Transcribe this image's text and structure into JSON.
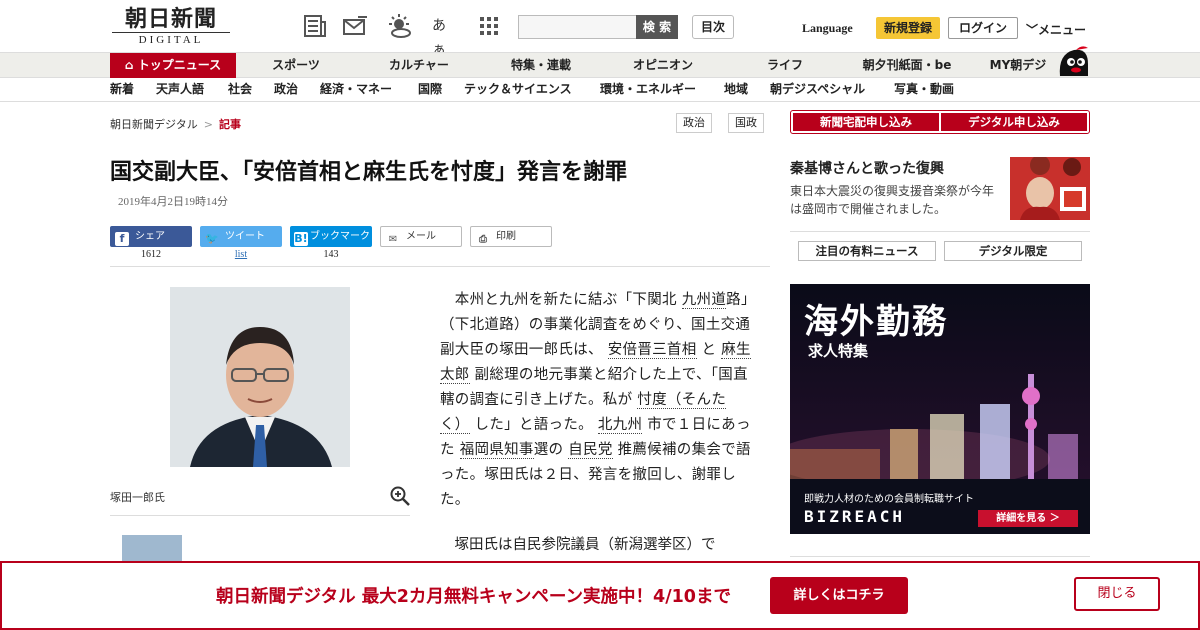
{
  "header": {
    "logo_main": "朝日新聞",
    "logo_sub": "DIGITAL",
    "icons": [
      "newspaper-icon",
      "mail-icon",
      "weather-icon",
      "font-size-icon",
      "grid-menu-icon"
    ],
    "font_icon_text": "あぁ",
    "search_placeholder": "",
    "search_button": "検 索",
    "contents_button": "目次",
    "language": "Language",
    "register": "新規登録",
    "login": "ログイン",
    "menu": "メニュー"
  },
  "main_nav": [
    {
      "label": "トップニュース",
      "active": true
    },
    {
      "label": "スポーツ"
    },
    {
      "label": "カルチャー"
    },
    {
      "label": "特集・連載"
    },
    {
      "label": "オピニオン"
    },
    {
      "label": "ライフ"
    },
    {
      "label": "朝夕刊紙面・be"
    },
    {
      "label": "MY朝デジ"
    }
  ],
  "sub_nav": [
    "新着",
    "天声人語",
    "社会",
    "政治",
    "経済・マネー",
    "国際",
    "テック＆サイエンス",
    "環境・エネルギー",
    "地域",
    "朝デジスペシャル",
    "写真・動画"
  ],
  "breadcrumb": {
    "home": "朝日新聞デジタル",
    "sep": ">",
    "current": "記事"
  },
  "tags": [
    "政治",
    "国政"
  ],
  "article": {
    "headline": "国交副大臣、「安倍首相と麻生氏を忖度」発言を謝罪",
    "date": "2019年4月2日19時14分",
    "photo_caption": "塚田一郎氏",
    "para2": "　塚田氏は自民参院議員（新潟選挙区）で"
  },
  "share": {
    "facebook": {
      "label": "シェア",
      "count": "1612"
    },
    "twitter": {
      "label": "ツイート",
      "count": "list"
    },
    "hatena": {
      "label": "ブックマーク",
      "count": "143"
    },
    "mail": "メール",
    "print": "印刷"
  },
  "body": {
    "p1": "　本州と九州を新たに結ぶ「下関北",
    "k1": "九州道",
    "p2": "路」（下北道路）の事業化調査をめぐり、国土交通副大臣の塚田一郎氏は、",
    "k2": "安倍晋三首相",
    "p3": "と",
    "k3": "麻生太郎",
    "p4": "副総理の地元事業と紹介した上で、「国直轄の調査に引き上げた。私が",
    "k4": "忖度（そんたく）",
    "p5": "した」と語った。",
    "k5": "北九州",
    "p6": "市で１日にあった",
    "k6": "福岡県知事",
    "p7": "選の",
    "k7": "自民党",
    "p8": "推薦候補の集会で語った。塚田氏は２日、発言を撤回し、謝罪した。"
  },
  "sidebar": {
    "subscribe_paper": "新聞宅配申し込み",
    "subscribe_digital": "デジタル申し込み",
    "promo_title": "秦基博さんと歌った復興",
    "promo_desc": "東日本大震災の復興支援音楽祭が今年は盛岡市で開催されました。",
    "tab_paid": "注目の有料ニュース",
    "tab_digital": "デジタル限定"
  },
  "ad": {
    "title": "海外勤務",
    "subtitle": "求人特集",
    "tagline": "即戦力人材のための会員制転職サイト",
    "brand": "BIZREACH",
    "button": "詳細を見る ＞"
  },
  "banner": {
    "text": "朝日新聞デジタル 最大2カ月無料キャンペーン実施中！4/10まで",
    "cta": "詳しくはコチラ",
    "close": "閉じる"
  },
  "colors": {
    "brand_red": "#b8001b",
    "facebook": "#3b5998",
    "twitter": "#55acee",
    "hatena": "#008fde",
    "register": "#f5c635"
  }
}
